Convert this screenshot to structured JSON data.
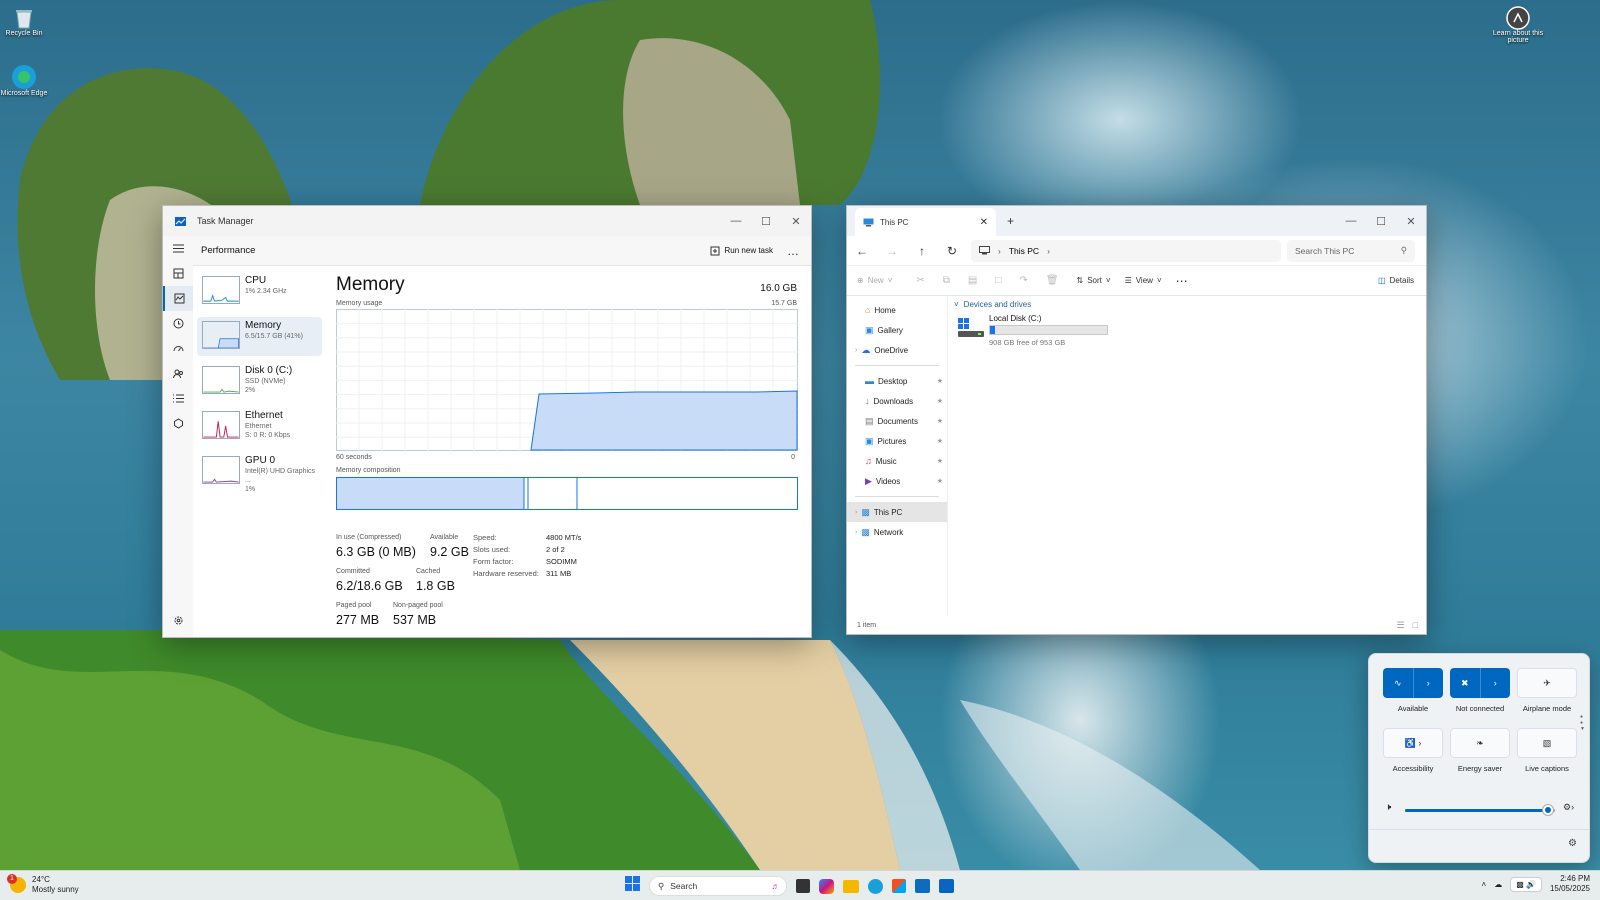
{
  "desktop": {
    "icons": [
      {
        "name": "recycle-bin",
        "label": "Recycle Bin"
      },
      {
        "name": "edge",
        "label": "Microsoft Edge"
      },
      {
        "name": "spotlight",
        "label": "Learn about this picture"
      }
    ]
  },
  "task_manager": {
    "title": "Task Manager",
    "page": "Performance",
    "run_new_task": "Run new task",
    "more": "…",
    "items": [
      {
        "name": "CPU",
        "sub1": "1%  2.34 GHz",
        "sub2": ""
      },
      {
        "name": "Memory",
        "sub1": "6.5/15.7 GB (41%)",
        "sub2": ""
      },
      {
        "name": "Disk 0 (C:)",
        "sub1": "SSD (NVMe)",
        "sub2": "2%"
      },
      {
        "name": "Ethernet",
        "sub1": "Ethernet",
        "sub2": "S: 0  R: 0 Kbps"
      },
      {
        "name": "GPU 0",
        "sub1": "Intel(R) UHD Graphics ...",
        "sub2": "1%"
      }
    ],
    "detail": {
      "heading": "Memory",
      "total": "16.0 GB",
      "usage_label": "Memory usage",
      "usage_max": "15.7 GB",
      "time_left": "60 seconds",
      "time_right": "0",
      "composition_label": "Memory composition",
      "stats": {
        "in_use_label": "In use (Compressed)",
        "in_use": "6.3 GB (0 MB)",
        "available_label": "Available",
        "available": "9.2 GB",
        "committed_label": "Committed",
        "committed": "6.2/18.6 GB",
        "cached_label": "Cached",
        "cached": "1.8 GB",
        "paged_label": "Paged pool",
        "paged": "277 MB",
        "nonpaged_label": "Non-paged pool",
        "nonpaged": "537 MB"
      },
      "specs": [
        {
          "k": "Speed:",
          "v": "4800 MT/s"
        },
        {
          "k": "Slots used:",
          "v": "2 of 2"
        },
        {
          "k": "Form factor:",
          "v": "SODIMM"
        },
        {
          "k": "Hardware reserved:",
          "v": "311 MB"
        }
      ]
    }
  },
  "explorer": {
    "tab_title": "This PC",
    "crumb": "This PC",
    "search_placeholder": "Search This PC",
    "toolbar": {
      "new": "New",
      "sort": "Sort",
      "view": "View",
      "details": "Details"
    },
    "nav": [
      {
        "label": "Home",
        "pinned": false
      },
      {
        "label": "Gallery",
        "pinned": false
      },
      {
        "label": "OneDrive",
        "pinned": false
      },
      {
        "label": "Desktop",
        "pinned": true
      },
      {
        "label": "Downloads",
        "pinned": true
      },
      {
        "label": "Documents",
        "pinned": true
      },
      {
        "label": "Pictures",
        "pinned": true
      },
      {
        "label": "Music",
        "pinned": true
      },
      {
        "label": "Videos",
        "pinned": true
      },
      {
        "label": "This PC",
        "pinned": false
      },
      {
        "label": "Network",
        "pinned": false
      }
    ],
    "section": "Devices and drives",
    "drive": {
      "name": "Local Disk (C:)",
      "free": "908 GB free of 953 GB",
      "used_fraction": 0.047
    },
    "status": "1 item"
  },
  "quick_settings": {
    "tiles": [
      {
        "label": "Available",
        "on": true
      },
      {
        "label": "Not connected",
        "on": true
      },
      {
        "label": "Airplane mode",
        "on": false
      },
      {
        "label": "Accessibility",
        "on": false
      },
      {
        "label": "Energy saver",
        "on": false
      },
      {
        "label": "Live captions",
        "on": false
      }
    ],
    "volume": 0.95
  },
  "taskbar": {
    "weather_temp": "24°C",
    "weather_desc": "Mostly sunny",
    "weather_badge": "1",
    "search": "Search",
    "time": "2:46 PM",
    "date": "15/05/2025"
  },
  "colors": {
    "accent": "#0067c0",
    "mem_fill": "#c9dcf7",
    "mem_line": "#1a73e8"
  }
}
